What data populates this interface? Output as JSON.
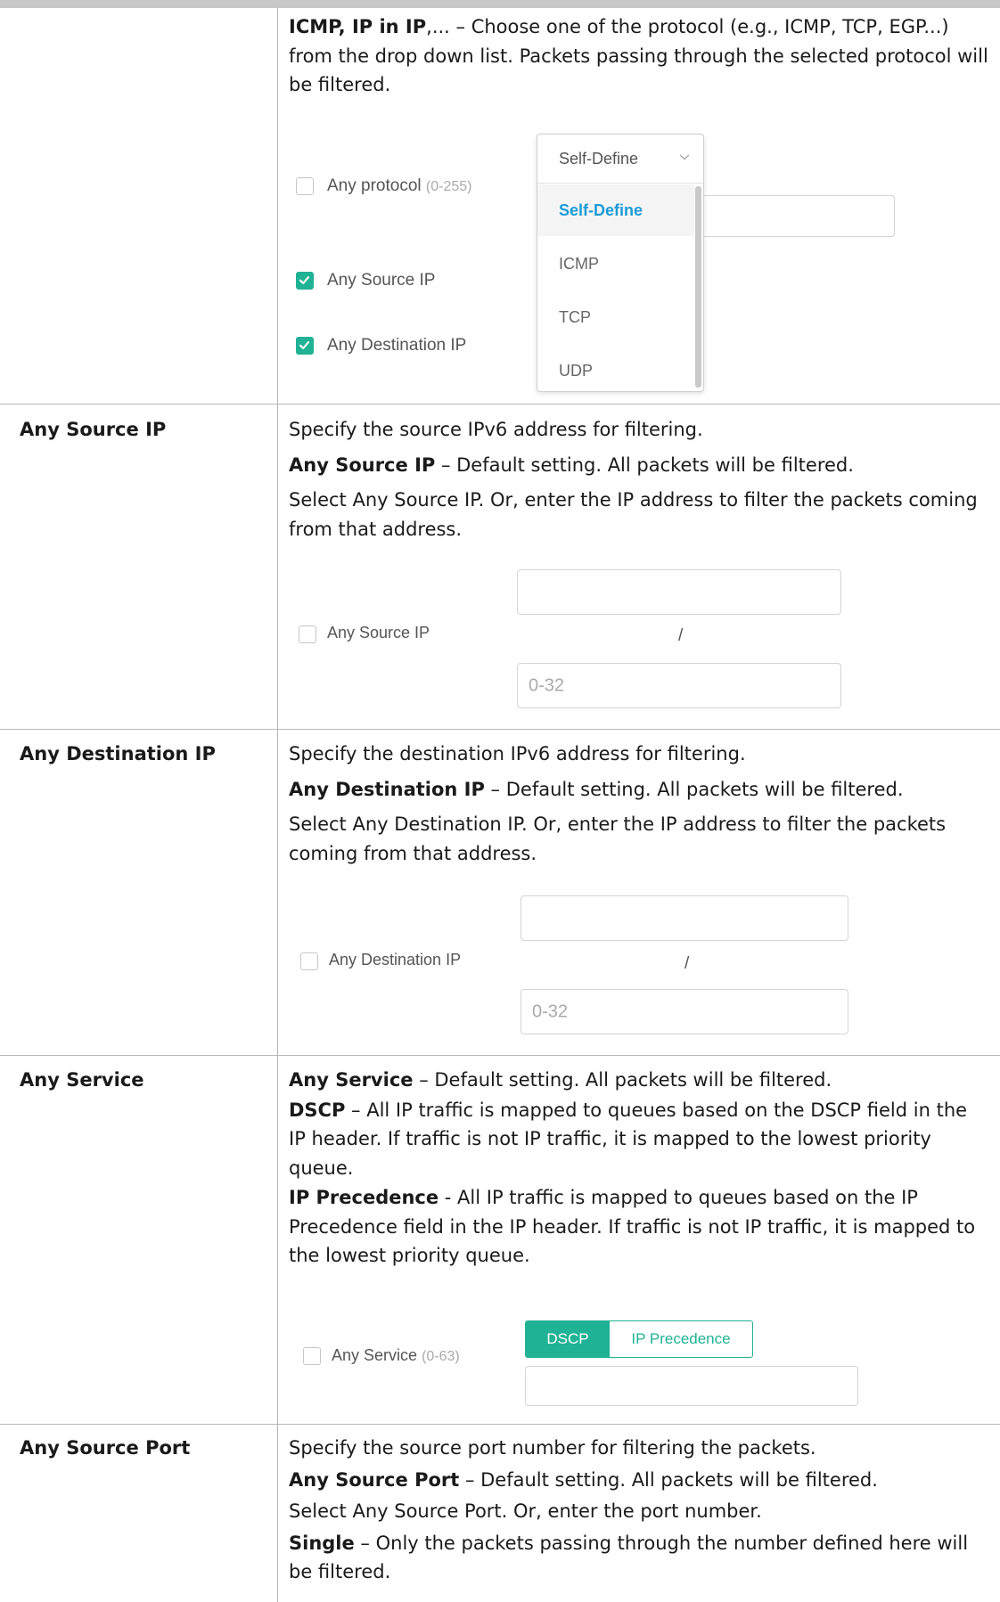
{
  "rows": [
    {
      "label": "",
      "paragraphs": [
        {
          "bold": "ICMP, IP in IP",
          "text": ",... – Choose one of the protocol (e.g., ICMP, TCP, EGP...) from the drop down list. Packets passing through the selected protocol will be filtered."
        }
      ],
      "ui": {
        "any_protocol_label": "Any protocol",
        "any_protocol_range": "(0-255)",
        "any_protocol_checked": false,
        "any_source_ip_label": "Any Source IP",
        "any_source_ip_checked": true,
        "any_destination_ip_label": "Any Destination IP",
        "any_destination_ip_checked": true,
        "protocol_select": {
          "value": "Self-Define",
          "options": [
            "Self-Define",
            "ICMP",
            "TCP",
            "UDP"
          ],
          "highlighted": "Self-Define"
        }
      }
    },
    {
      "label": "Any Source IP",
      "paragraphs": [
        {
          "bold": "",
          "text": "Specify the source IPv6 address for filtering."
        },
        {
          "bold": "Any Source IP",
          "text": " – Default setting. All packets will be filtered."
        },
        {
          "bold": "",
          "text": "Select Any Source IP. Or, enter the IP address to filter the packets coming from that address."
        }
      ],
      "ui": {
        "checkbox_label": "Any Source IP",
        "checked": false,
        "slash": "/",
        "prefix_placeholder": "0-32"
      }
    },
    {
      "label": "Any Destination IP",
      "paragraphs": [
        {
          "bold": "",
          "text": "Specify the destination IPv6 address for filtering."
        },
        {
          "bold": "Any Destination IP",
          "text": " – Default setting. All packets will be filtered."
        },
        {
          "bold": "",
          "text": "Select Any Destination IP. Or, enter the IP address to filter the packets coming from that address."
        }
      ],
      "ui": {
        "checkbox_label": "Any Destination IP",
        "checked": false,
        "slash": "/",
        "prefix_placeholder": "0-32"
      }
    },
    {
      "label": "Any Service",
      "paragraphs": [
        {
          "bold": "Any Service",
          "text": " – Default setting. All packets will be filtered."
        },
        {
          "bold": "DSCP",
          "text": " – All IP traffic is mapped to queues based on the DSCP field in the IP header. If traffic is not IP traffic, it is mapped to the lowest priority queue."
        },
        {
          "bold": "IP Precedence",
          "text": " - All IP traffic is mapped to queues based on the IP Precedence field in the IP header. If traffic is not IP traffic, it is mapped to the lowest priority queue."
        }
      ],
      "ui": {
        "checkbox_label": "Any Service",
        "range": "(0-63)",
        "checked": false,
        "tabs": [
          "DSCP",
          "IP Precedence"
        ],
        "active_tab": "DSCP"
      }
    },
    {
      "label": "Any Source Port",
      "paragraphs": [
        {
          "bold": "",
          "text": "Specify the source port number for filtering the packets."
        },
        {
          "bold": "Any Source Port",
          "text": " – Default setting. All packets will be filtered."
        },
        {
          "bold": "",
          "text": "Select Any Source Port. Or, enter the port number."
        },
        {
          "bold": "Single",
          "text": " – Only the packets passing through the number defined here will be filtered."
        }
      ]
    }
  ],
  "colors": {
    "accent_green": "#1fb294",
    "selected_blue": "#1a9bd7",
    "border": "#b8b8b8"
  }
}
